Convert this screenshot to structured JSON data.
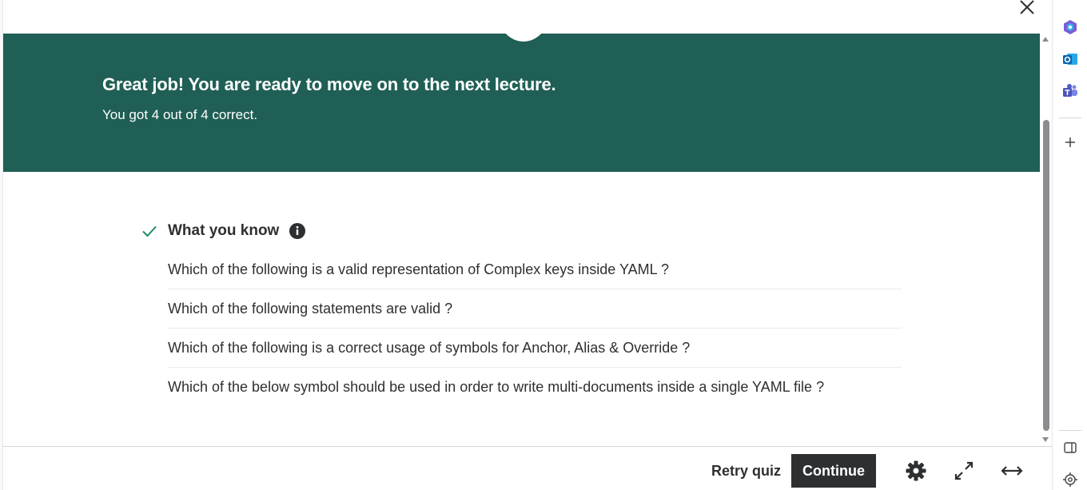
{
  "banner": {
    "title": "Great job! You are ready to move on to the next lecture.",
    "subtitle": "You got 4 out of 4 correct."
  },
  "summary": {
    "heading": "What you know",
    "questions": [
      "Which of the following is a valid representation of Complex keys inside YAML ?",
      "Which of the following statements are valid ?",
      "Which of the following is a correct usage of symbols for Anchor, Alias & Override ?",
      "Which of the below symbol should be used in order to write multi-documents inside a single YAML file ?"
    ]
  },
  "footer": {
    "retry_label": "Retry quiz",
    "continue_label": "Continue"
  },
  "icons": {
    "close": "close-icon",
    "check": "check-icon",
    "info": "info-icon",
    "settings": "gear-icon",
    "fullscreen": "expand-icon",
    "wide": "horizontal-arrows-icon"
  },
  "colors": {
    "banner_bg": "#1f5f55",
    "check": "#1f8a70",
    "continue_bg": "#2d2f31"
  }
}
